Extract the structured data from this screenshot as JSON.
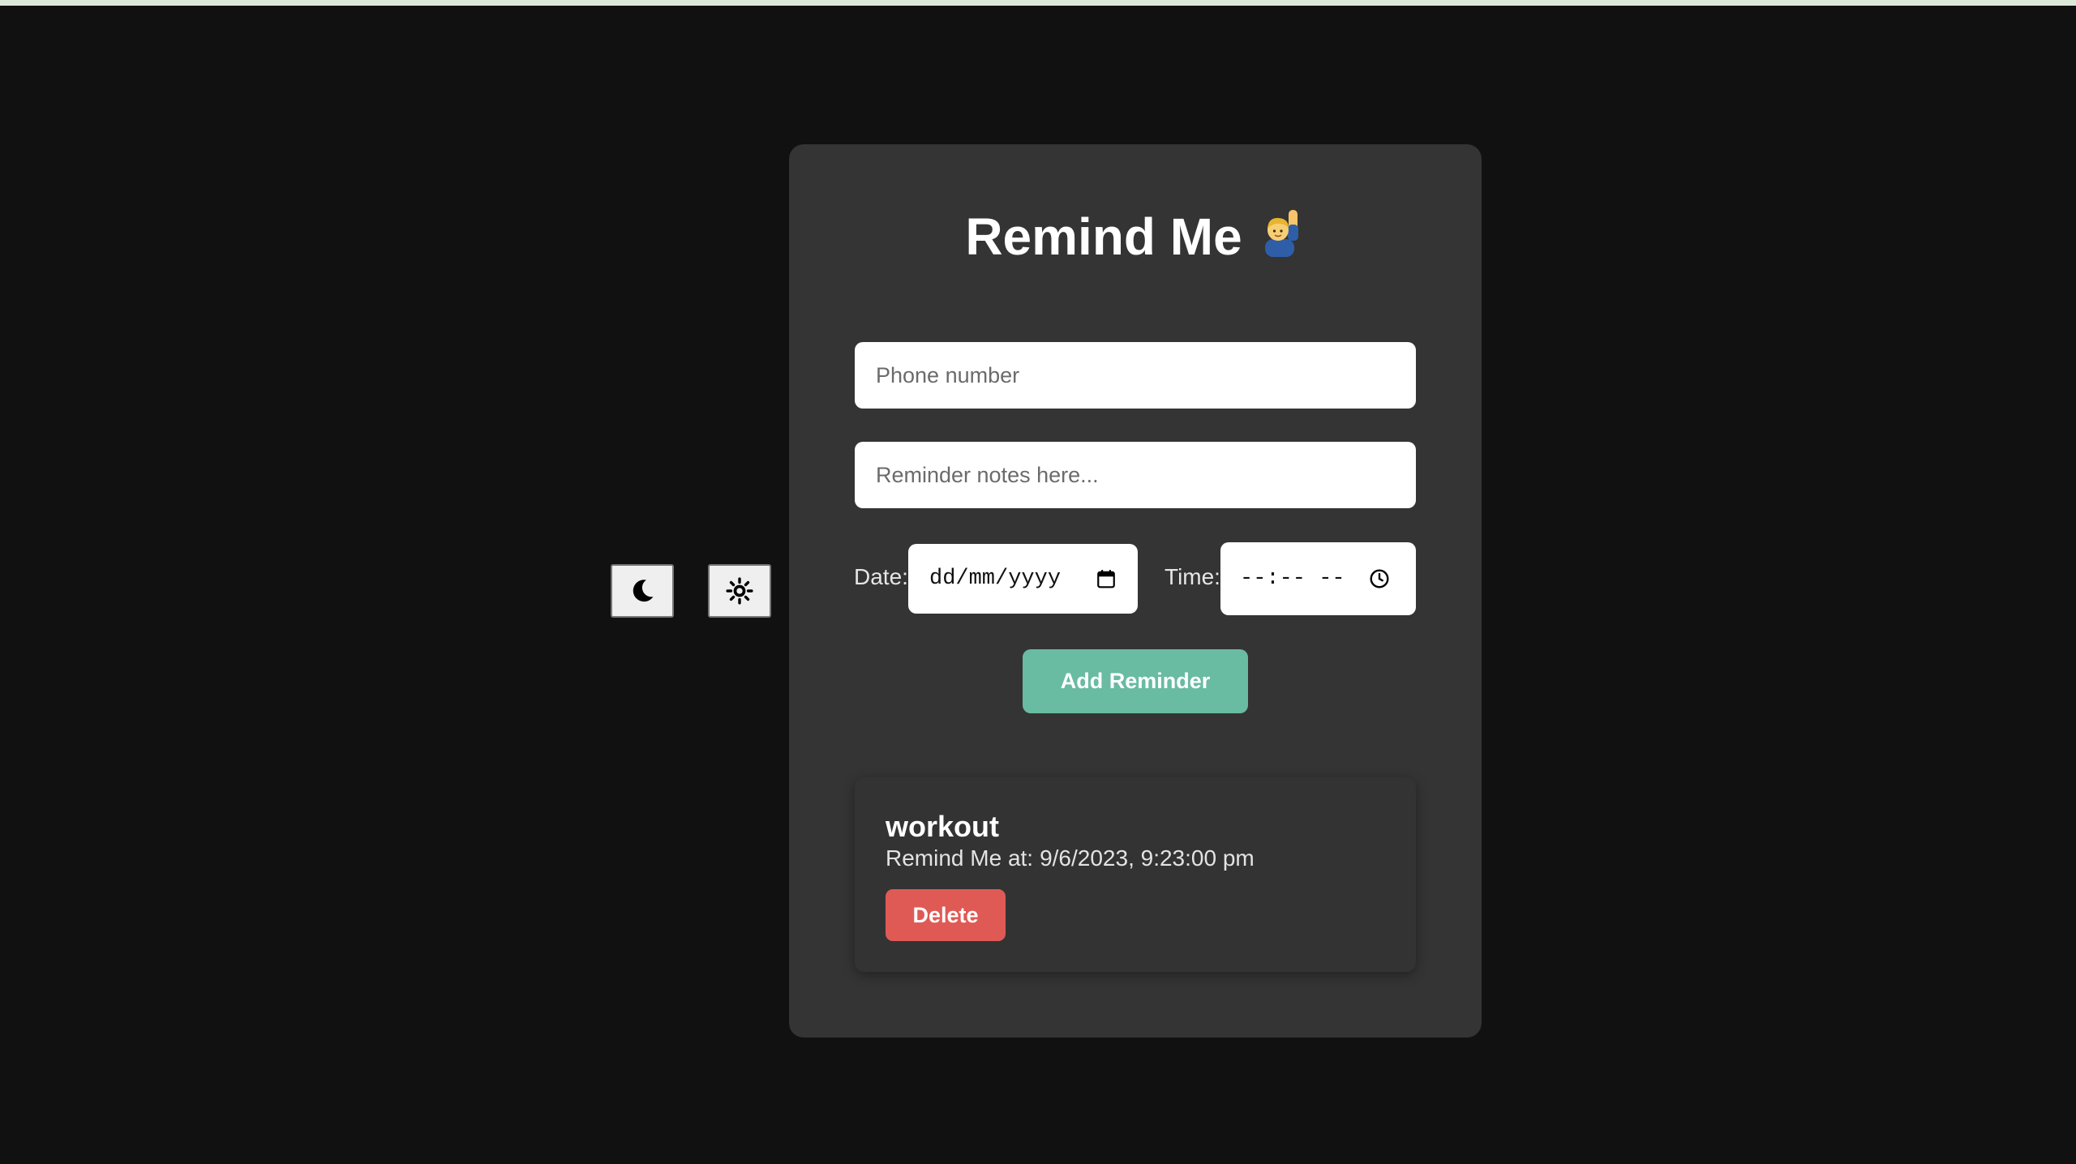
{
  "app": {
    "title": "Remind Me",
    "title_emoji": "🙋‍♂️"
  },
  "theme_toggle": {
    "dark_icon": "moon-icon",
    "light_icon": "sun-icon"
  },
  "form": {
    "phone_placeholder": "Phone number",
    "phone_value": "",
    "notes_placeholder": "Reminder notes here...",
    "notes_value": "",
    "date_label": "Date:",
    "date_value": "dd/mm/yyyy",
    "date_icon": "calendar-icon",
    "time_label": "Time:",
    "time_value": "--:-- --",
    "time_icon": "clock-icon",
    "add_button_label": "Add Reminder"
  },
  "reminders": [
    {
      "title": "workout",
      "prefix": "Remind Me at:",
      "when": "9/6/2023, 9:23:00 pm",
      "delete_label": "Delete"
    }
  ],
  "colors": {
    "background": "#111111",
    "card": "#343434",
    "accent": "#69bba1",
    "danger": "#e05a55"
  }
}
